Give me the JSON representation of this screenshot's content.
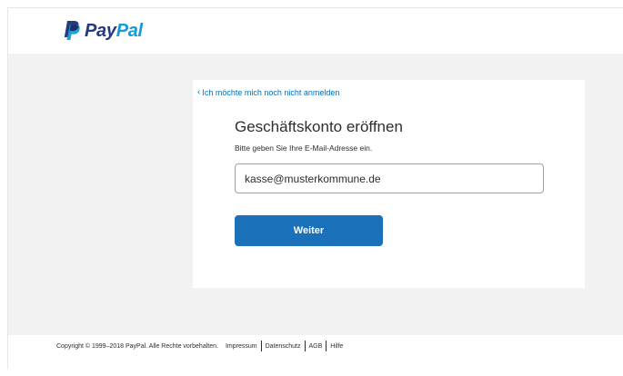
{
  "header": {
    "logo_text_pay": "Pay",
    "logo_text_pal": "Pal"
  },
  "card": {
    "back_link": "Ich möchte mich noch nicht anmelden",
    "title": "Geschäftskonto eröffnen",
    "subtitle": "Bitte geben Sie Ihre E-Mail-Adresse ein.",
    "email_value": "kasse@musterkommune.de",
    "continue_label": "Weiter"
  },
  "footer": {
    "copyright": "Copyright © 1999–2018 PayPal. Alle Rechte vorbehalten.",
    "links": [
      "Impressum",
      "Datenschutz",
      "AGB",
      "Hilfe"
    ]
  },
  "colors": {
    "brand_dark": "#253b80",
    "brand_light": "#179bd7",
    "button": "#1b70ba",
    "link": "#0070ba",
    "band": "#f2f2f2"
  }
}
